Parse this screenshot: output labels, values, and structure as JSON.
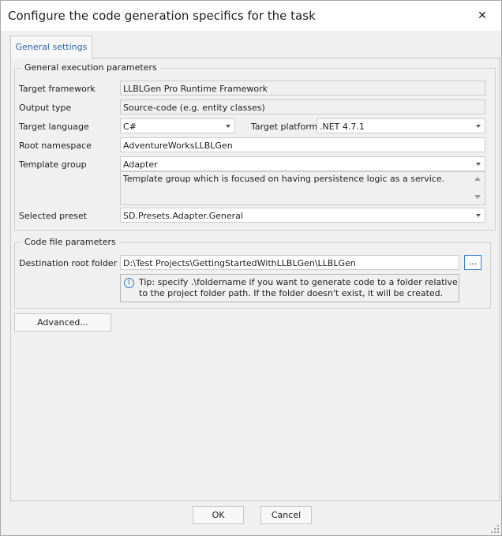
{
  "window": {
    "title": "Configure the code generation specifics for the task",
    "close_glyph": "✕"
  },
  "tabs": [
    {
      "label": "General settings"
    }
  ],
  "general_params": {
    "title": "General execution parameters",
    "target_framework": {
      "label": "Target framework",
      "value": "LLBLGen Pro Runtime Framework"
    },
    "output_type": {
      "label": "Output type",
      "value": "Source-code (e.g. entity classes)"
    },
    "target_language": {
      "label": "Target language",
      "value": "C#"
    },
    "target_platform": {
      "label": "Target platform",
      "value": ".NET 4.7.1"
    },
    "root_namespace": {
      "label": "Root namespace",
      "value": "AdventureWorksLLBLGen"
    },
    "template_group": {
      "label": "Template group",
      "value": "Adapter",
      "description": "Template group which is focused on having persistence logic as a service."
    },
    "selected_preset": {
      "label": "Selected preset",
      "value": "SD.Presets.Adapter.General"
    }
  },
  "code_file_params": {
    "title": "Code file parameters",
    "destination_root_folder": {
      "label": "Destination root folder",
      "value": "D:\\Test Projects\\GettingStartedWithLLBLGen\\LLBLGen",
      "browse_label": "..."
    },
    "tip": "Tip: specify .\\foldername if you want to generate code to a folder relative to the project folder path. If the folder doesn't exist, it will be created.",
    "tip_icon": "info-icon"
  },
  "buttons": {
    "advanced": "Advanced...",
    "ok": "OK",
    "cancel": "Cancel"
  },
  "colors": {
    "tab_text": "#2b67b0",
    "focus_border": "#3c7fd3",
    "info_icon": "#2b7bd6"
  }
}
